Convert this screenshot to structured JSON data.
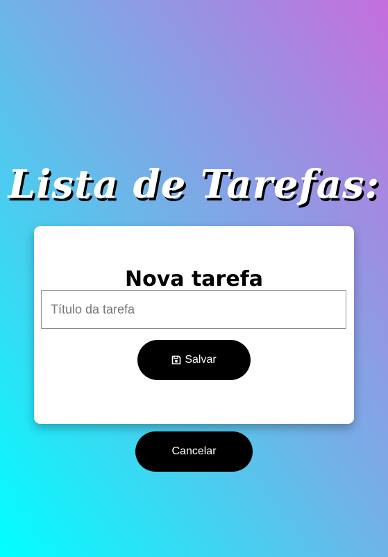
{
  "page": {
    "title": "Lista de Tarefas:"
  },
  "card": {
    "title": "Nova tarefa",
    "input": {
      "placeholder": "Título da tarefa",
      "value": ""
    },
    "save_button": {
      "label": "Salvar",
      "icon": "floppy-disk-icon"
    }
  },
  "cancel_button": {
    "label": "Cancelar"
  },
  "colors": {
    "gradient_bottom_left": "#00ffff",
    "gradient_top_right": "#c56edd",
    "card_background": "#ffffff",
    "button_background": "#000000",
    "button_text": "#ffffff"
  }
}
